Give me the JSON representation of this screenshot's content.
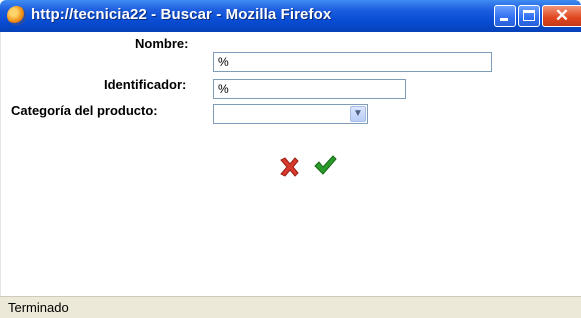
{
  "window": {
    "title": "http://tecnicia22 - Buscar - Mozilla Firefox"
  },
  "form": {
    "nombre_label": "Nombre:",
    "nombre_value": "%",
    "identificador_label": "Identificador:",
    "identificador_value": "%",
    "categoria_label": "Categoría del producto:",
    "categoria_value": ""
  },
  "actions": {
    "cancel_icon": "close-x-icon",
    "accept_icon": "checkmark-icon"
  },
  "status": {
    "text": "Terminado"
  },
  "colors": {
    "titlebar": "#0a4fd7",
    "cancel": "#d63a2c",
    "accept": "#1f8a1f"
  }
}
